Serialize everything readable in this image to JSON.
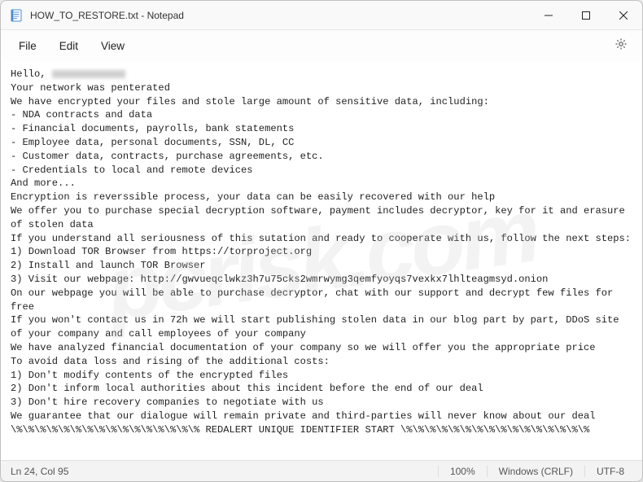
{
  "window": {
    "title": "HOW_TO_RESTORE.txt - Notepad"
  },
  "menu": {
    "file": "File",
    "edit": "Edit",
    "view": "View"
  },
  "content": {
    "greeting_prefix": "Hello, ",
    "line2": "Your network was penterated",
    "line3": "We have encrypted your files and stole large amount of sensitive data, including:",
    "bullet1": "- NDA contracts and data",
    "bullet2": "- Financial documents, payrolls, bank statements",
    "bullet3": "- Employee data, personal documents, SSN, DL, CC",
    "bullet4": "- Customer data, contracts, purchase agreements, etc.",
    "bullet5": "- Credentials to local and remote devices",
    "line9": "And more...",
    "line10": "Encryption is reverssible process, your data can be easily recovered with our help",
    "line11": "We offer you to purchase special decryption software, payment includes decryptor, key for it and erasure of stolen data",
    "line12": "If you understand all seriousness of this sutation and ready to cooperate with us, follow the next steps:",
    "step1": "1) Download TOR Browser from https://torproject.org",
    "step2": "2) Install and launch TOR Browser",
    "step3": "3) Visit our webpage: http://gwvueqclwkz3h7u75cks2wmrwymg3qemfyoyqs7vexkx7lhlteagmsyd.onion",
    "line16": "On our webpage you will be able to purchase decryptor, chat with our support and decrypt few files for free",
    "line17": "If you won't contact us in 72h we will start publishing stolen data in our blog part by part, DDoS site of your company and call employees of your company",
    "line18": "We have analyzed financial documentation of your company so we will offer you the appropriate price",
    "line19": "To avoid data loss and rising of the additional costs:",
    "avoid1": "1) Don't modify contents of the encrypted files",
    "avoid2": "2) Don't inform local authorities about this incident before the end of our deal",
    "avoid3": "3) Don't hire recovery companies to negotiate with us",
    "line23": "We guarantee that our dialogue will remain private and third-parties will never know about our deal",
    "line24": "\\%\\%\\%\\%\\%\\%\\%\\%\\%\\%\\%\\%\\%\\%\\%\\% REDALERT UNIQUE IDENTIFIER START \\%\\%\\%\\%\\%\\%\\%\\%\\%\\%\\%\\%\\%\\%\\%\\%"
  },
  "statusbar": {
    "position": "Ln 24, Col 95",
    "zoom": "100%",
    "line_ending": "Windows (CRLF)",
    "encoding": "UTF-8"
  },
  "watermark": "pcrisk.com"
}
